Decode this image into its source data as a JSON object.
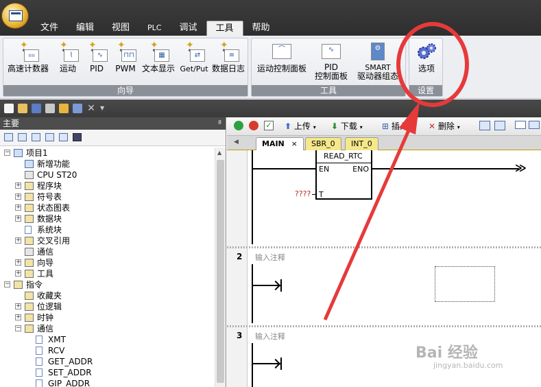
{
  "menu": {
    "items": [
      "文件",
      "编辑",
      "视图",
      "PLC",
      "调试",
      "工具",
      "帮助"
    ],
    "active_index": 5
  },
  "ribbon": {
    "groups": [
      {
        "label": "向导",
        "buttons": [
          "高速计数器",
          "运动",
          "PID",
          "PWM",
          "文本显示",
          "Get/Put",
          "数据日志"
        ]
      },
      {
        "label": "工具",
        "buttons": [
          "运动控制面板",
          "PID\n控制面板",
          "SMART\n驱动器组态"
        ]
      },
      {
        "label": "设置",
        "buttons": [
          "选项"
        ]
      }
    ],
    "pid_panel_line1": "PID",
    "pid_panel_line2": "控制面板",
    "smart_line1": "SMART",
    "smart_line2": "驱动器组态"
  },
  "left_panel": {
    "title": "主要",
    "pin": "ª",
    "tree": [
      {
        "label": "项目1",
        "level": 0,
        "expander": "−",
        "icon": "project-icon"
      },
      {
        "label": "新增功能",
        "level": 1,
        "expander": "",
        "icon": "help-icon"
      },
      {
        "label": "CPU ST20",
        "level": 1,
        "expander": "",
        "icon": "cpu-icon"
      },
      {
        "label": "程序块",
        "level": 1,
        "expander": "+",
        "icon": "folder-icon"
      },
      {
        "label": "符号表",
        "level": 1,
        "expander": "+",
        "icon": "folder-icon"
      },
      {
        "label": "状态图表",
        "level": 1,
        "expander": "+",
        "icon": "folder-icon"
      },
      {
        "label": "数据块",
        "level": 1,
        "expander": "+",
        "icon": "folder-icon"
      },
      {
        "label": "系统块",
        "level": 1,
        "expander": "",
        "icon": "system-block-icon"
      },
      {
        "label": "交叉引用",
        "level": 1,
        "expander": "+",
        "icon": "folder-icon"
      },
      {
        "label": "通信",
        "level": 1,
        "expander": "",
        "icon": "communication-icon"
      },
      {
        "label": "向导",
        "level": 1,
        "expander": "+",
        "icon": "wizard-icon"
      },
      {
        "label": "工具",
        "level": 1,
        "expander": "+",
        "icon": "tools-icon"
      },
      {
        "label": "指令",
        "level": 0,
        "expander": "−",
        "icon": "instructions-icon"
      },
      {
        "label": "收藏夹",
        "level": 1,
        "expander": "",
        "icon": "favorites-icon"
      },
      {
        "label": "位逻辑",
        "level": 1,
        "expander": "+",
        "icon": "bit-logic-icon"
      },
      {
        "label": "时钟",
        "level": 1,
        "expander": "+",
        "icon": "clock-icon"
      },
      {
        "label": "通信",
        "level": 1,
        "expander": "−",
        "icon": "communication-folder-icon"
      },
      {
        "label": "XMT",
        "level": 2,
        "expander": "",
        "icon": "instruction-icon"
      },
      {
        "label": "RCV",
        "level": 2,
        "expander": "",
        "icon": "instruction-icon"
      },
      {
        "label": "GET_ADDR",
        "level": 2,
        "expander": "",
        "icon": "instruction-icon"
      },
      {
        "label": "SET_ADDR",
        "level": 2,
        "expander": "",
        "icon": "instruction-icon"
      },
      {
        "label": "GIP_ADDR",
        "level": 2,
        "expander": "",
        "icon": "instruction-icon"
      }
    ]
  },
  "editor": {
    "toolbar": {
      "upload": "上传",
      "download": "下载",
      "insert": "插入",
      "delete": "删除"
    },
    "tabs": [
      {
        "label": "MAIN",
        "close": "×"
      },
      {
        "label": "SBR_0"
      },
      {
        "label": "INT_0"
      }
    ],
    "block": {
      "name": "READ_RTC",
      "en": "EN",
      "eno": "ENO",
      "t_pin": "T",
      "t_value": "????"
    },
    "rungs": [
      {
        "number": "2",
        "comment": "输入注释"
      },
      {
        "number": "3",
        "comment": "输入注释"
      }
    ]
  },
  "watermark": {
    "logo": "Bai 经验",
    "url": "jingyan.baidu.com"
  },
  "colors": {
    "highlight": "#e63a3a",
    "ribbon_group_label": "#8a8f98",
    "tab_yellow": "#f5e88a"
  }
}
